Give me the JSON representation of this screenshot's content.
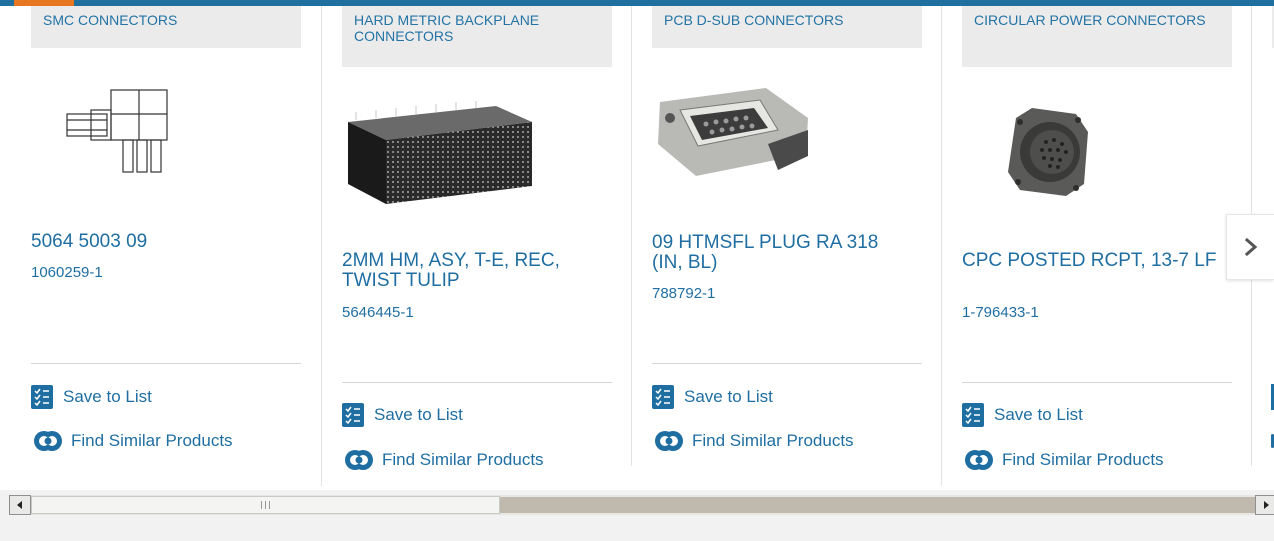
{
  "colors": {
    "link": "#1f6ea2",
    "topbar": "#1f6f9f",
    "accent": "#e87722",
    "category_bg": "#ebebeb"
  },
  "actions": {
    "save_label": "Save to List",
    "find_label": "Find Similar Products"
  },
  "icons": {
    "save": "checklist-icon",
    "find": "find-similar-icon",
    "next": "chevron-right-icon"
  },
  "cards": [
    {
      "category": "SMC CONNECTORS",
      "name": "5064 5003 09",
      "part_number": "1060259-1",
      "image": "smc-connector-drawing"
    },
    {
      "category": "HARD METRIC BACKPLANE CONNECTORS",
      "name": "2MM HM, ASY, T-E, REC, TWIST TULIP",
      "part_number": "5646445-1",
      "image": "backplane-connector-photo"
    },
    {
      "category": "PCB D-SUB CONNECTORS",
      "name": "09 HTMSFL PLUG RA 318 (IN, BL)",
      "part_number": "788792-1",
      "image": "dsub-connector-photo"
    },
    {
      "category": "CIRCULAR POWER CONNECTORS",
      "name": "CPC POSTED RCPT, 13-7 LF",
      "part_number": "1-796433-1",
      "image": "circular-connector-photo"
    }
  ],
  "scrollbar": {
    "position_fraction": 0.0,
    "visible_fraction": 0.38
  }
}
